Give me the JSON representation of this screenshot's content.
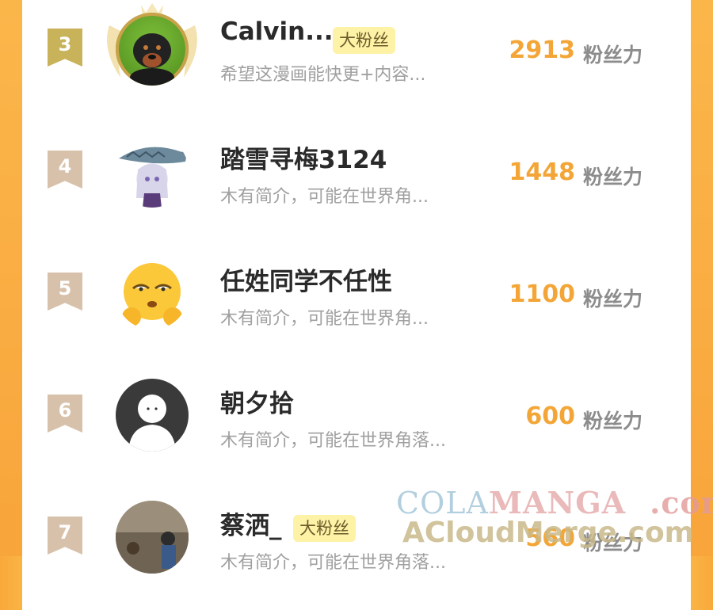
{
  "rows": [
    {
      "rank": "3",
      "name": "Calvin...",
      "badge": "大粉丝",
      "desc": "希望这漫画能快更+内容...",
      "score": "2913",
      "unit": "粉丝力"
    },
    {
      "rank": "4",
      "name": "踏雪寻梅3124",
      "badge": "",
      "desc": "木有简介，可能在世界角...",
      "score": "1448",
      "unit": "粉丝力"
    },
    {
      "rank": "5",
      "name": "任姓同学不任性",
      "badge": "",
      "desc": "木有简介，可能在世界角...",
      "score": "1100",
      "unit": "粉丝力"
    },
    {
      "rank": "6",
      "name": "朝夕拾",
      "badge": "",
      "desc": "木有简介，可能在世界角落...",
      "score": "600",
      "unit": "粉丝力"
    },
    {
      "rank": "7",
      "name": "蔡洒_",
      "badge": "大粉丝",
      "desc": "木有简介，可能在世界角落...",
      "score": "560",
      "unit": "粉丝力"
    }
  ],
  "watermark": {
    "line1_a": "COLA",
    "line1_b": "MANGA",
    "line1_c": ".com",
    "line2": "ACloudMerge.com"
  },
  "colors": {
    "accent": "#f3a637",
    "badge_bg": "#fdf2a6",
    "side": "#f9a93a"
  }
}
